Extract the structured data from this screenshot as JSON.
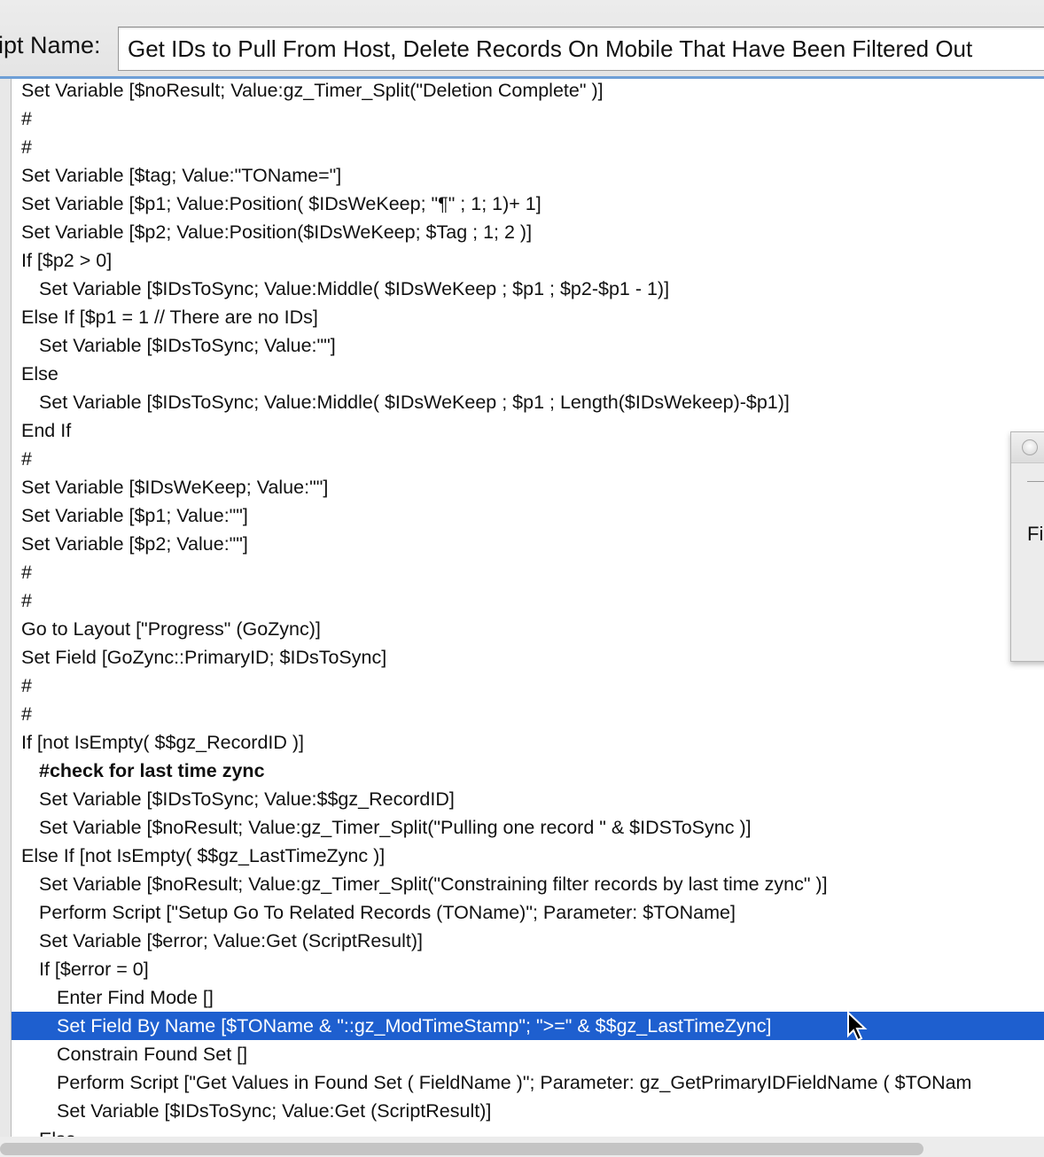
{
  "header": {
    "name_label": "ipt Name:",
    "script_name": "Get IDs to Pull From Host, Delete Records On Mobile That Have Been Filtered Out"
  },
  "script_lines": [
    {
      "text": "Set Variable [$noResult; Value:gz_Timer_Split(\"Deletion Complete\" )]",
      "indent": 0
    },
    {
      "text": "#",
      "indent": 0
    },
    {
      "text": "#",
      "indent": 0
    },
    {
      "text": "Set Variable [$tag; Value:\"TOName=\"]",
      "indent": 0
    },
    {
      "text": "Set Variable [$p1; Value:Position( $IDsWeKeep; \"¶\" ; 1; 1)+ 1]",
      "indent": 0
    },
    {
      "text": "Set Variable [$p2; Value:Position($IDsWeKeep; $Tag ; 1; 2 )]",
      "indent": 0
    },
    {
      "text": "If [$p2 > 0]",
      "indent": 0
    },
    {
      "text": "Set Variable [$IDsToSync; Value:Middle( $IDsWeKeep ; $p1 ; $p2-$p1 - 1)]",
      "indent": 1
    },
    {
      "text": "Else If [$p1 = 1 // There are no IDs]",
      "indent": 0
    },
    {
      "text": "Set Variable [$IDsToSync; Value:\"\"]",
      "indent": 1
    },
    {
      "text": "Else",
      "indent": 0
    },
    {
      "text": "Set Variable [$IDsToSync; Value:Middle( $IDsWeKeep ; $p1 ; Length($IDsWekeep)-$p1)]",
      "indent": 1
    },
    {
      "text": "End If",
      "indent": 0
    },
    {
      "text": "#",
      "indent": 0
    },
    {
      "text": "Set Variable [$IDsWeKeep; Value:\"\"]",
      "indent": 0
    },
    {
      "text": "Set Variable [$p1; Value:\"\"]",
      "indent": 0
    },
    {
      "text": "Set Variable [$p2; Value:\"\"]",
      "indent": 0
    },
    {
      "text": "#",
      "indent": 0
    },
    {
      "text": "#",
      "indent": 0
    },
    {
      "text": "Go to Layout [\"Progress\" (GoZync)]",
      "indent": 0
    },
    {
      "text": "Set Field [GoZync::PrimaryID; $IDsToSync]",
      "indent": 0
    },
    {
      "text": "#",
      "indent": 0
    },
    {
      "text": "#",
      "indent": 0
    },
    {
      "text": "If [not IsEmpty( $$gz_RecordID )]",
      "indent": 0
    },
    {
      "text": "#check for last time zync",
      "indent": 1,
      "bold": true
    },
    {
      "text": "Set Variable [$IDsToSync; Value:$$gz_RecordID]",
      "indent": 1
    },
    {
      "text": "Set Variable [$noResult; Value:gz_Timer_Split(\"Pulling one record \"  &  $IDSToSync )]",
      "indent": 1
    },
    {
      "text": "Else If [not IsEmpty( $$gz_LastTimeZync )]",
      "indent": 0
    },
    {
      "text": "Set Variable [$noResult; Value:gz_Timer_Split(\"Constraining filter records by last time zync\" )]",
      "indent": 1
    },
    {
      "text": "Perform Script [\"Setup Go To Related Records (TOName)\"; Parameter: $TOName]",
      "indent": 1
    },
    {
      "text": "Set Variable [$error; Value:Get (ScriptResult)]",
      "indent": 1
    },
    {
      "text": "If [$error = 0]",
      "indent": 1
    },
    {
      "text": "Enter Find Mode []",
      "indent": 2
    },
    {
      "text": "Set Field By Name [$TOName & \"::gz_ModTimeStamp\"; \">=\" & $$gz_LastTimeZync]",
      "indent": 2,
      "selected": true
    },
    {
      "text": "Constrain Found Set []",
      "indent": 2
    },
    {
      "text": "Perform Script [\"Get Values in Found Set ( FieldName )\"; Parameter: gz_GetPrimaryIDFieldName ( $TONam",
      "indent": 2
    },
    {
      "text": "Set Variable [$IDsToSync; Value:Get (ScriptResult)]",
      "indent": 2
    },
    {
      "text": "Else",
      "indent": 1
    }
  ],
  "dialog": {
    "partial_text": "Fi"
  }
}
